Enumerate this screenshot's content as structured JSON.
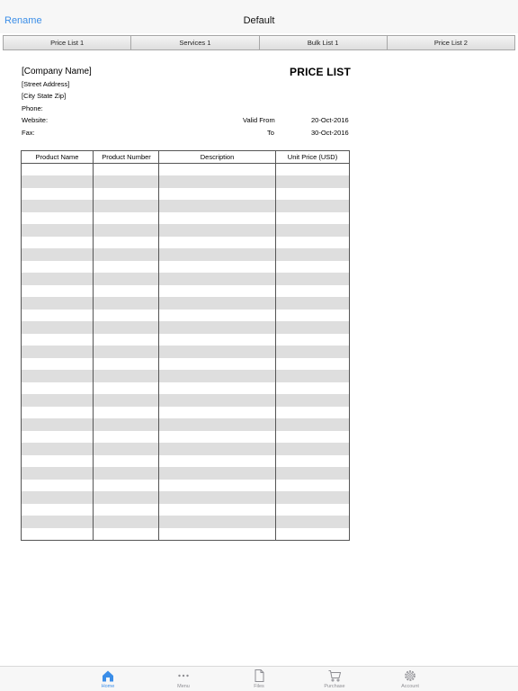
{
  "navbar": {
    "left_label": "Rename",
    "title": "Default"
  },
  "sheet_tabs": [
    "Price List 1",
    "Services 1",
    "Bulk List 1",
    "Price List 2"
  ],
  "document": {
    "company_name": "[Company Name]",
    "title": "PRICE LIST",
    "street": "[Street Address]",
    "city": "[City State Zip]",
    "phone_label": "Phone:",
    "website_label": "Website:",
    "fax_label": "Fax:",
    "valid_from_label": "Valid From",
    "valid_from_value": "20-Oct-2016",
    "to_label": "To",
    "to_value": "30-Oct-2016"
  },
  "table": {
    "headers": [
      "Product Name",
      "Product Number",
      "Description",
      "Unit Price (USD)"
    ]
  },
  "tabbar": {
    "items": [
      {
        "label": "Home",
        "icon": "home-icon"
      },
      {
        "label": "Menu",
        "icon": "more-icon"
      },
      {
        "label": "Files",
        "icon": "file-icon"
      },
      {
        "label": "Purchase",
        "icon": "cart-icon"
      },
      {
        "label": "Account",
        "icon": "gear-icon"
      }
    ],
    "active": "Home"
  },
  "colors": {
    "accent": "#3b8ee8",
    "stripe": "#dedede",
    "inactive": "#8e8e93"
  }
}
